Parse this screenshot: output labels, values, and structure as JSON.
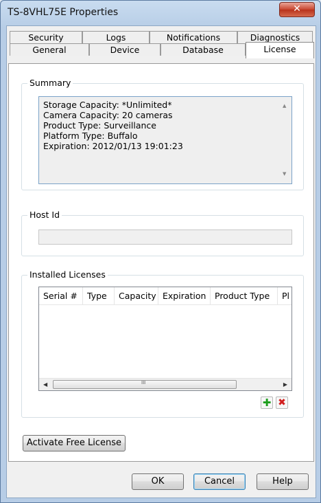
{
  "window": {
    "title": "TS-8VHL75E Properties",
    "close_glyph": "✕"
  },
  "tabs": {
    "row1": [
      "Security",
      "Logs",
      "Notifications",
      "Diagnostics"
    ],
    "row2": [
      "General",
      "Device",
      "Database",
      "License"
    ],
    "active": "License"
  },
  "summary": {
    "label": "Summary",
    "lines": [
      "Storage Capacity:  *Unlimited*",
      "Camera Capacity:  20 cameras",
      "Product Type:  Surveillance",
      "Platform Type:  Buffalo",
      "Expiration:  2012/01/13 19:01:23"
    ]
  },
  "host_id": {
    "label": "Host Id",
    "value": ""
  },
  "installed_licenses": {
    "label": "Installed Licenses",
    "columns": [
      "Serial #",
      "Type",
      "Capacity",
      "Expiration",
      "Product Type",
      "Pl"
    ],
    "rows": [],
    "scroll_grip": "III"
  },
  "buttons": {
    "add_glyph": "✚",
    "remove_glyph": "✖",
    "activate_free_license": "Activate Free License",
    "ok": "OK",
    "cancel": "Cancel",
    "help": "Help"
  },
  "colors": {
    "accent_border": "#7aa2c8",
    "add_green": "#1e9e1e",
    "remove_red": "#d11e1e"
  }
}
